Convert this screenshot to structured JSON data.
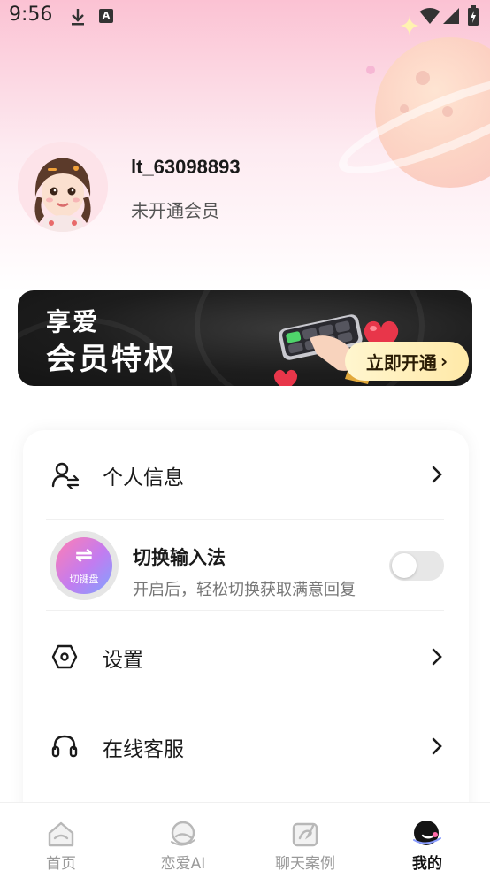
{
  "status_bar": {
    "time": "9:56",
    "icons": [
      "download-icon",
      "a-icon",
      "wifi-icon",
      "signal-icon",
      "battery-icon"
    ],
    "a_icon_letter": "A"
  },
  "profile": {
    "username": "lt_63098893",
    "member_status": "未开通会员"
  },
  "vip_banner": {
    "line1": "享爱",
    "line2": "会员特权",
    "button_label": "立即开通",
    "button_chevron": "›"
  },
  "menu": {
    "personal_info": {
      "label": "个人信息",
      "icon": "user-exchange-icon"
    },
    "ime_switch": {
      "title": "切换输入法",
      "subtitle": "开启后，轻松切换获取满意回复",
      "badge_symbol": "⇌",
      "badge_text": "切键盘",
      "enabled": false
    },
    "settings": {
      "label": "设置",
      "icon": "hexagon-settings-icon"
    },
    "online_service": {
      "label": "在线客服",
      "icon": "headset-icon"
    }
  },
  "tab_bar": {
    "tabs": [
      {
        "label": "首页",
        "active": false,
        "icon": "home-icon"
      },
      {
        "label": "恋爱AI",
        "active": false,
        "icon": "love-ai-icon"
      },
      {
        "label": "聊天案例",
        "active": false,
        "icon": "chat-case-icon"
      },
      {
        "label": "我的",
        "active": true,
        "icon": "mine-icon"
      }
    ]
  },
  "colors": {
    "header_pink": "#fbc2d3",
    "banner_dark": "#1d1d1d",
    "button_gold": "#ffe9a8",
    "toggle_off": "#e7e7e7"
  }
}
